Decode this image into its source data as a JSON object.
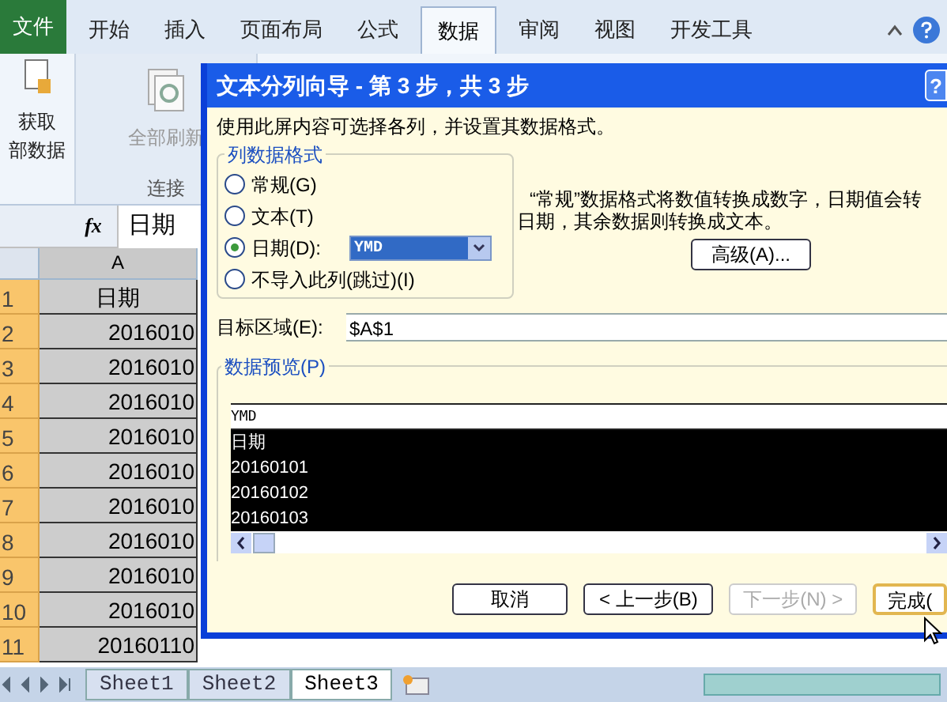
{
  "ribbon": {
    "tabs": [
      {
        "label": "文件",
        "kind": "file",
        "selected": false
      },
      {
        "label": "开始",
        "kind": "tab",
        "selected": false
      },
      {
        "label": "插入",
        "kind": "tab",
        "selected": false
      },
      {
        "label": "页面布局",
        "kind": "tab",
        "selected": false
      },
      {
        "label": "公式",
        "kind": "tab",
        "selected": false
      },
      {
        "label": "数据",
        "kind": "tab",
        "selected": true
      },
      {
        "label": "审阅",
        "kind": "tab",
        "selected": false
      },
      {
        "label": "视图",
        "kind": "tab",
        "selected": false
      },
      {
        "label": "开发工具",
        "kind": "tab",
        "selected": false
      }
    ],
    "commands": [
      {
        "label": "获取",
        "label_2": "部数据",
        "disabled": false
      },
      {
        "label": "全部刷新",
        "disabled": true
      }
    ],
    "group_label": "连接"
  },
  "formula_bar": {
    "fx": "fx",
    "value": "日期"
  },
  "sheet": {
    "column": "A",
    "rows": [
      {
        "number": "1",
        "value": "日期"
      },
      {
        "number": "2",
        "value": "2016010"
      },
      {
        "number": "3",
        "value": "2016010"
      },
      {
        "number": "4",
        "value": "2016010"
      },
      {
        "number": "5",
        "value": "2016010"
      },
      {
        "number": "6",
        "value": "2016010"
      },
      {
        "number": "7",
        "value": "2016010"
      },
      {
        "number": "8",
        "value": "2016010"
      },
      {
        "number": "9",
        "value": "2016010"
      },
      {
        "number": "10",
        "value": "2016010"
      },
      {
        "number": "11",
        "value": "20160110"
      }
    ]
  },
  "sheet_tabs": [
    {
      "label": "Sheet1",
      "selected": false
    },
    {
      "label": "Sheet2",
      "selected": false
    },
    {
      "label": "Sheet3",
      "selected": true
    }
  ],
  "dialog": {
    "title": "文本分列向导 - 第 3 步，共 3 步",
    "help": "?",
    "instructions": "使用此屏内容可选择各列，并设置其数据格式。",
    "format_group": "列数据格式",
    "formats": [
      {
        "label": "常规(G)",
        "selected": false
      },
      {
        "label": "文本(T)",
        "selected": false
      },
      {
        "label": "日期(D):",
        "selected": true,
        "dropdown": "YMD"
      },
      {
        "label": "不导入此列(跳过)(I)",
        "selected": false
      }
    ],
    "description": [
      "“常规”数据格式将数值转换成数字，日期值会转",
      "日期，其余数据则转换成文本。"
    ],
    "advanced_button": "高级(A)...",
    "destination_label": "目标区域(E):",
    "destination": "$A$1",
    "preview_label": "数据预览(P)",
    "preview_header": "YMD",
    "preview_rows": [
      "日期",
      "20160101",
      "20160102",
      "20160103"
    ],
    "buttons": [
      {
        "label": "取消",
        "disabled": false
      },
      {
        "label": "< 上一步(B)",
        "disabled": false
      },
      {
        "label": "下一步(N) >",
        "disabled": true
      },
      {
        "label": "完成(",
        "disabled": false
      }
    ]
  }
}
